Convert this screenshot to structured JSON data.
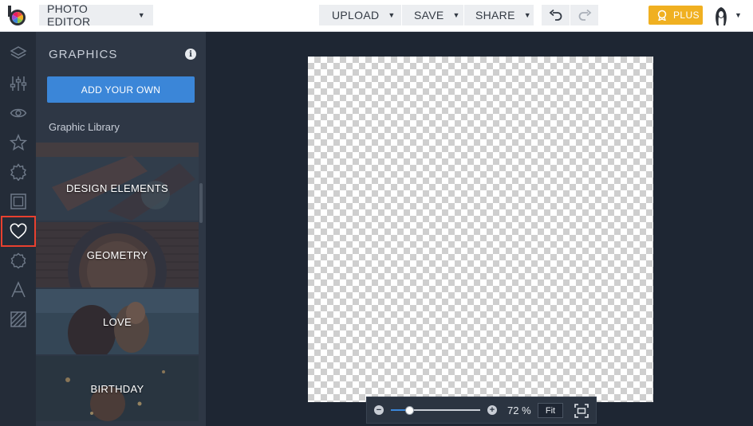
{
  "topbar": {
    "editor_label": "PHOTO EDITOR",
    "upload_label": "UPLOAD",
    "save_label": "SAVE",
    "share_label": "SHARE",
    "plus_label": "PLUS",
    "icons": {
      "logo": "befunky-logo-icon",
      "undo": "undo-icon",
      "redo": "redo-icon",
      "plus": "plus-badge-icon",
      "avatar": "avatar-icon"
    }
  },
  "rail": {
    "items": [
      {
        "icon": "layers-icon"
      },
      {
        "icon": "sliders-icon"
      },
      {
        "icon": "eye-icon"
      },
      {
        "icon": "star-icon"
      },
      {
        "icon": "badge-icon"
      },
      {
        "icon": "frame-icon"
      },
      {
        "icon": "heart-icon",
        "active": true
      },
      {
        "icon": "gear-shape-icon"
      },
      {
        "icon": "text-icon"
      },
      {
        "icon": "texture-icon"
      }
    ]
  },
  "panel": {
    "title": "GRAPHICS",
    "add_button": "ADD YOUR OWN",
    "library_label": "Graphic Library",
    "tiles": [
      {
        "label": "DESIGN ELEMENTS"
      },
      {
        "label": "GEOMETRY"
      },
      {
        "label": "LOVE"
      },
      {
        "label": "BIRTHDAY"
      }
    ]
  },
  "zoom": {
    "value_label": "72 %",
    "level": 0.21,
    "fit_label": "Fit"
  },
  "colors": {
    "accent": "#3b86d8",
    "plus": "#f0b021",
    "active_outline": "#e8402f"
  }
}
